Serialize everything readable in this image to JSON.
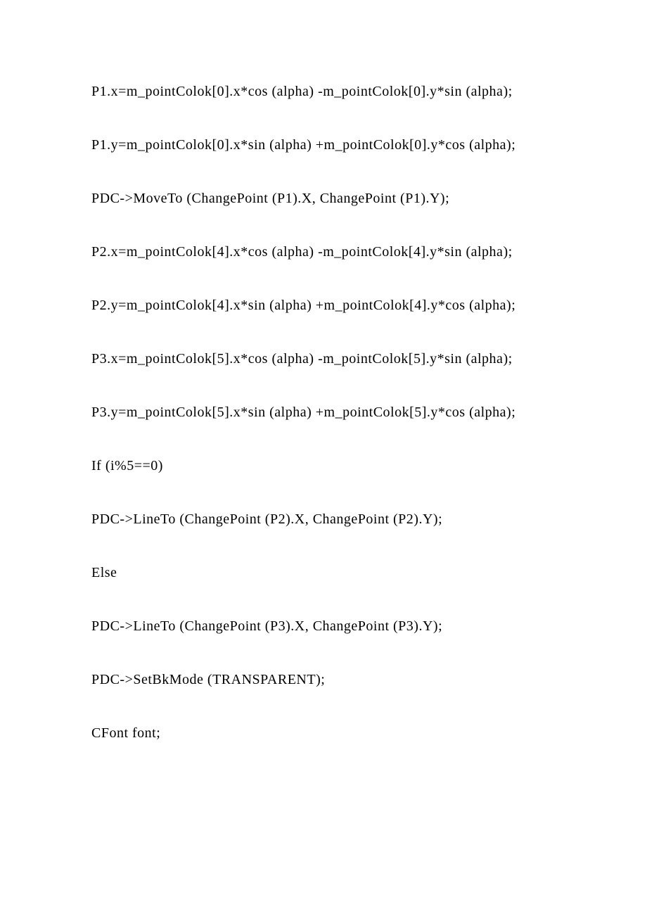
{
  "lines": [
    "P1.x=m_pointColok[0].x*cos (alpha) -m_pointColok[0].y*sin (alpha);",
    "P1.y=m_pointColok[0].x*sin (alpha) +m_pointColok[0].y*cos (alpha);",
    "PDC->MoveTo (ChangePoint (P1).X, ChangePoint (P1).Y);",
    "P2.x=m_pointColok[4].x*cos (alpha) -m_pointColok[4].y*sin (alpha);",
    "P2.y=m_pointColok[4].x*sin (alpha) +m_pointColok[4].y*cos (alpha);",
    "P3.x=m_pointColok[5].x*cos (alpha) -m_pointColok[5].y*sin (alpha);",
    "P3.y=m_pointColok[5].x*sin (alpha) +m_pointColok[5].y*cos (alpha);",
    "If (i%5==0)",
    "PDC->LineTo (ChangePoint (P2).X, ChangePoint (P2).Y);",
    "Else",
    "PDC->LineTo (ChangePoint (P3).X, ChangePoint (P3).Y);",
    "PDC->SetBkMode (TRANSPARENT);",
    "CFont font;"
  ]
}
